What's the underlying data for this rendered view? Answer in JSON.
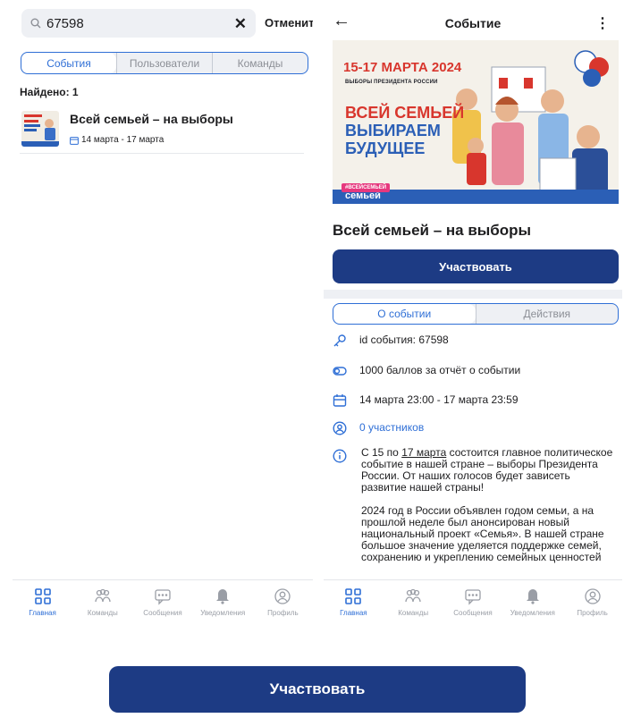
{
  "search": {
    "query": "67598",
    "cancel": "Отменить",
    "tabs": [
      "События",
      "Пользователи",
      "Команды"
    ],
    "found": "Найдено: 1"
  },
  "result": {
    "title": "Всей семьей – на выборы",
    "dates": "14 марта - 17 марта"
  },
  "tabbar": {
    "items": [
      "Главная",
      "Команды",
      "Сообщения",
      "Уведомления",
      "Профиль"
    ]
  },
  "event": {
    "header_title": "Событие",
    "banner": {
      "dates": "15-17 МАРТА 2024",
      "subtitle": "ВЫБОРЫ ПРЕЗИДЕНТА РОССИИ",
      "line1": "ВСЕЙ СЕМЬЕЙ",
      "line2": "ВЫБИРАЕМ",
      "line3": "БУДУЩЕЕ",
      "hashtag": "#ВСЕЙСЕМЬЕЙ",
      "brand": "семьей"
    },
    "title": "Всей семьей – на выборы",
    "participate": "Участвовать",
    "tabs": [
      "О событии",
      "Действия"
    ],
    "info": {
      "id": "id события: 67598",
      "points": "1000 баллов за отчёт о событии",
      "datetime": "14 марта 23:00 - 17 марта 23:59",
      "participants": "0 участников"
    },
    "description": {
      "p1_pre": "С 15 по ",
      "p1_link": "17 марта",
      "p1_post": " состоится главное политическое событие в нашей стране – выборы Президента России. От наших голосов будет зависеть развитие нашей страны!",
      "p2": "2024 год в России объявлен годом семьи, а на прошлой неделе был анонсирован новый национальный проект «Семья». В нашей стране большое значение уделяется поддержке семей, сохранению и укреплению семейных ценностей"
    }
  },
  "big_button": "Участвовать",
  "colors": {
    "accent": "#2f6fd6",
    "button": "#1d3b84",
    "banner_red": "#d8362d",
    "banner_blue": "#2b5fb6",
    "hashtag": "#e6387e"
  }
}
